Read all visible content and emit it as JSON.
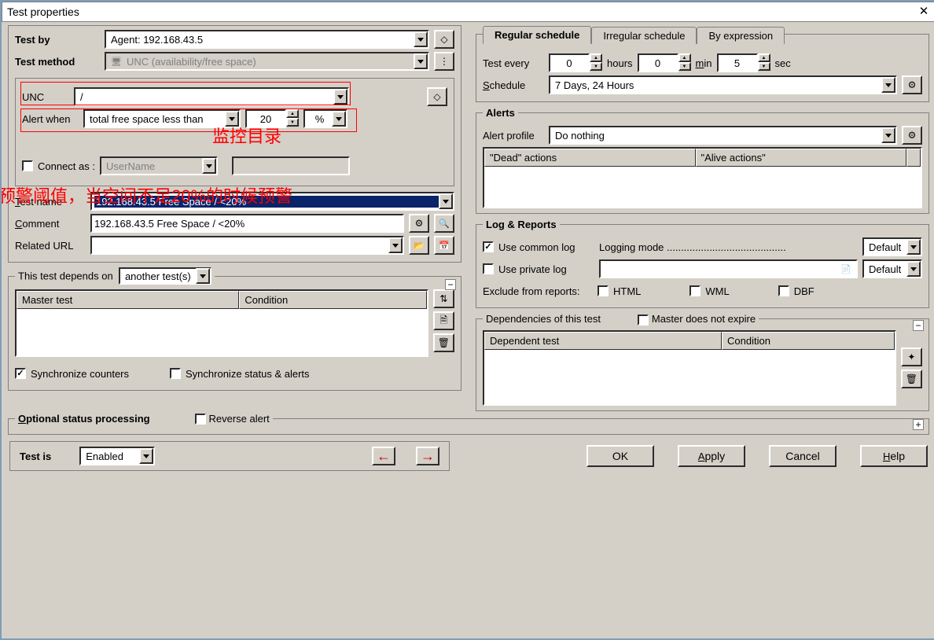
{
  "title": "Test properties",
  "test_by_label": "Test by",
  "test_by_value": "Agent: 192.168.43.5",
  "test_method_label": "Test method",
  "test_method_value": "UNC (availability/free space)",
  "unc_label": "UNC",
  "unc_value": "/",
  "alert_when_label": "Alert when",
  "alert_when_mode": "total free space less than",
  "alert_when_value": "20",
  "alert_when_unit": "%",
  "connect_as_label": "Connect as :",
  "connect_as_user": "UserName",
  "test_name_label": "Test name",
  "test_name_value": "192.168.43.5 Free Space / <20%",
  "comment_label": "Comment",
  "comment_value": "192.168.43.5 Free Space / <20%",
  "related_url_label": "Related URL",
  "depends_label": "This test depends on",
  "depends_mode": "another test(s)",
  "mt_col": "Master test",
  "cond_col": "Condition",
  "sync_counters": "Synchronize counters",
  "sync_status": "Synchronize status & alerts",
  "osp_label": "Optional status processing",
  "reverse_label": "Reverse alert",
  "test_is_label": "Test is",
  "test_is_value": "Enabled",
  "sched": {
    "tab_regular": "Regular schedule",
    "tab_irregular": "Irregular schedule",
    "tab_expr": "By expression",
    "test_every": "Test every",
    "hours_v": "0",
    "hours_l": "hours",
    "min_v": "0",
    "min_l": "min",
    "sec_v": "5",
    "sec_l": "sec",
    "schedule_label": "Schedule",
    "schedule_value": "7 Days, 24 Hours"
  },
  "alerts": {
    "legend": "Alerts",
    "profile_label": "Alert profile",
    "profile_value": "Do nothing",
    "dead": "\"Dead\" actions",
    "alive": "\"Alive actions\""
  },
  "log": {
    "legend": "Log & Reports",
    "common": "Use common log",
    "logging_mode": "Logging mode ..........................................",
    "default": "Default",
    "private": "Use private log",
    "exclude": "Exclude from reports:",
    "html": "HTML",
    "wml": "WML",
    "dbf": "DBF"
  },
  "deps_of": {
    "legend": "Dependencies of this test",
    "master_exp": "Master does not expire",
    "dep_col": "Dependent test",
    "cond_col": "Condition"
  },
  "btns": {
    "ok": "OK",
    "apply": "Apply",
    "cancel": "Cancel",
    "help": "Help"
  },
  "annotations": {
    "monitor_dir": "监控目录",
    "threshold": "预警阈值，当空间不足20%的时候预警"
  }
}
